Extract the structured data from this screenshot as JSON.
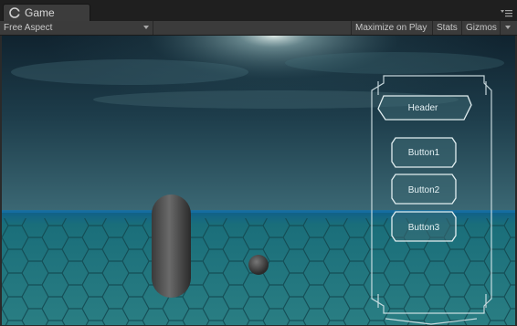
{
  "window": {
    "tab_title": "Game",
    "tab_icon": "unity-icon",
    "tab_menu_icon": "tab-menu-icon"
  },
  "toolbar": {
    "aspect_label": "Free Aspect",
    "maximize_label": "Maximize on Play",
    "stats_label": "Stats",
    "gizmos_label": "Gizmos"
  },
  "scene": {
    "sky_color_top": "#0f2533",
    "sky_color_horizon": "#35606d",
    "floor_color": "#1f6f78",
    "ui_panel": {
      "header_label": "Header",
      "buttons": [
        "Button1",
        "Button2",
        "Button3"
      ]
    }
  }
}
